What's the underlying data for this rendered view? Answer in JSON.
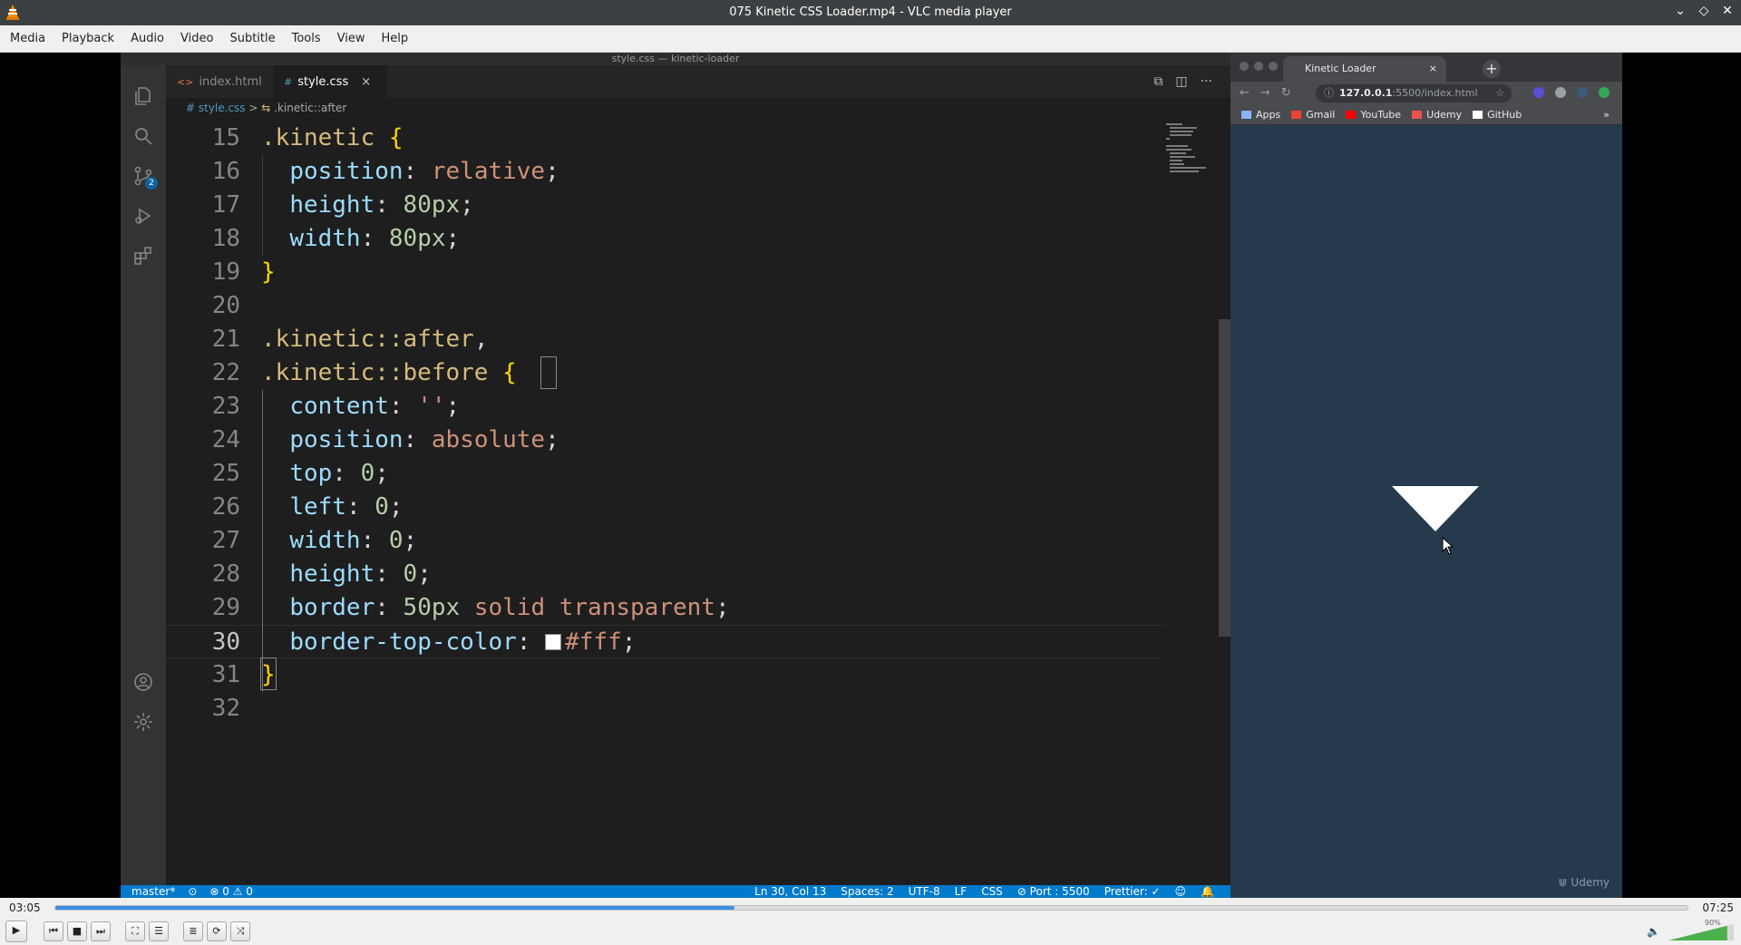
{
  "window": {
    "title": "075 Kinetic CSS Loader.mp4 - VLC media player",
    "controls": [
      "minimize-icon",
      "maximize-icon",
      "close-icon"
    ]
  },
  "menu": [
    "Media",
    "Playback",
    "Audio",
    "Video",
    "Subtitle",
    "Tools",
    "View",
    "Help"
  ],
  "vscode": {
    "window_title": "style.css — kinetic-loader",
    "tabs": [
      {
        "label": "index.html",
        "icon": "html-icon",
        "active": false
      },
      {
        "label": "style.css",
        "icon": "css-icon",
        "active": true,
        "close": "×"
      }
    ],
    "breadcrumb": {
      "file": "# style.css",
      "separator": ">",
      "symbol": ".kinetic::after"
    },
    "tab_actions": [
      "⧉",
      "◫",
      "···"
    ],
    "code_lines": [
      {
        "n": "15",
        "code": [
          {
            "t": "sel",
            "v": ".kinetic "
          },
          {
            "t": "brace",
            "v": "{"
          }
        ]
      },
      {
        "n": "16",
        "code": [
          {
            "t": "sp",
            "v": "  "
          },
          {
            "t": "prop",
            "v": "position"
          },
          {
            "t": "punc",
            "v": ": "
          },
          {
            "t": "val",
            "v": "relative"
          },
          {
            "t": "punc",
            "v": ";"
          }
        ]
      },
      {
        "n": "17",
        "code": [
          {
            "t": "sp",
            "v": "  "
          },
          {
            "t": "prop",
            "v": "height"
          },
          {
            "t": "punc",
            "v": ": "
          },
          {
            "t": "num",
            "v": "80px"
          },
          {
            "t": "punc",
            "v": ";"
          }
        ]
      },
      {
        "n": "18",
        "code": [
          {
            "t": "sp",
            "v": "  "
          },
          {
            "t": "prop",
            "v": "width"
          },
          {
            "t": "punc",
            "v": ": "
          },
          {
            "t": "num",
            "v": "80px"
          },
          {
            "t": "punc",
            "v": ";"
          }
        ]
      },
      {
        "n": "19",
        "code": [
          {
            "t": "brace",
            "v": "}"
          }
        ]
      },
      {
        "n": "20",
        "code": []
      },
      {
        "n": "21",
        "code": [
          {
            "t": "sel",
            "v": ".kinetic::after"
          },
          {
            "t": "punc",
            "v": ","
          }
        ]
      },
      {
        "n": "22",
        "code": [
          {
            "t": "sel",
            "v": ".kinetic::before "
          },
          {
            "t": "brace",
            "v": "{"
          }
        ]
      },
      {
        "n": "23",
        "code": [
          {
            "t": "sp",
            "v": "  "
          },
          {
            "t": "prop",
            "v": "content"
          },
          {
            "t": "punc",
            "v": ": "
          },
          {
            "t": "val",
            "v": "''"
          },
          {
            "t": "punc",
            "v": ";"
          }
        ]
      },
      {
        "n": "24",
        "code": [
          {
            "t": "sp",
            "v": "  "
          },
          {
            "t": "prop",
            "v": "position"
          },
          {
            "t": "punc",
            "v": ": "
          },
          {
            "t": "val",
            "v": "absolute"
          },
          {
            "t": "punc",
            "v": ";"
          }
        ]
      },
      {
        "n": "25",
        "code": [
          {
            "t": "sp",
            "v": "  "
          },
          {
            "t": "prop",
            "v": "top"
          },
          {
            "t": "punc",
            "v": ": "
          },
          {
            "t": "num",
            "v": "0"
          },
          {
            "t": "punc",
            "v": ";"
          }
        ]
      },
      {
        "n": "26",
        "code": [
          {
            "t": "sp",
            "v": "  "
          },
          {
            "t": "prop",
            "v": "left"
          },
          {
            "t": "punc",
            "v": ": "
          },
          {
            "t": "num",
            "v": "0"
          },
          {
            "t": "punc",
            "v": ";"
          }
        ]
      },
      {
        "n": "27",
        "code": [
          {
            "t": "sp",
            "v": "  "
          },
          {
            "t": "prop",
            "v": "width"
          },
          {
            "t": "punc",
            "v": ": "
          },
          {
            "t": "num",
            "v": "0"
          },
          {
            "t": "punc",
            "v": ";"
          }
        ]
      },
      {
        "n": "28",
        "code": [
          {
            "t": "sp",
            "v": "  "
          },
          {
            "t": "prop",
            "v": "height"
          },
          {
            "t": "punc",
            "v": ": "
          },
          {
            "t": "num",
            "v": "0"
          },
          {
            "t": "punc",
            "v": ";"
          }
        ]
      },
      {
        "n": "29",
        "code": [
          {
            "t": "sp",
            "v": "  "
          },
          {
            "t": "prop",
            "v": "border"
          },
          {
            "t": "punc",
            "v": ": "
          },
          {
            "t": "num",
            "v": "50px"
          },
          {
            "t": "val",
            "v": " solid transparent"
          },
          {
            "t": "punc",
            "v": ";"
          }
        ]
      },
      {
        "n": "30",
        "code": [
          {
            "t": "sp",
            "v": "  "
          },
          {
            "t": "prop",
            "v": "border-top-color"
          },
          {
            "t": "punc",
            "v": ": "
          },
          {
            "t": "swatch",
            "v": ""
          },
          {
            "t": "val",
            "v": "#fff"
          },
          {
            "t": "punc",
            "v": ";"
          }
        ]
      },
      {
        "n": "31",
        "code": [
          {
            "t": "brace",
            "v": "}"
          }
        ]
      },
      {
        "n": "32",
        "code": []
      }
    ],
    "current_line": "30",
    "status": {
      "branch": "master*",
      "sync": "⊙",
      "problems": "⊗ 0 ⚠ 0",
      "position": "Ln 30, Col 13",
      "spaces": "Spaces: 2",
      "encoding": "UTF-8",
      "eol": "LF",
      "language": "CSS",
      "port": "⊘ Port : 5500",
      "prettier": "Prettier: ✓"
    }
  },
  "browser": {
    "tab_title": "Kinetic Loader",
    "tab_close": "×",
    "new_tab": "+",
    "url_host": "127.0.0.1",
    "url_path": ":5500/index.html",
    "bookmarks": [
      {
        "label": "Apps",
        "icon": "apps-icon",
        "color": "#8ab4f8"
      },
      {
        "label": "Gmail",
        "icon": "gmail-icon",
        "color": "#ea4335"
      },
      {
        "label": "YouTube",
        "icon": "youtube-icon",
        "color": "#ff0000"
      },
      {
        "label": "Udemy",
        "icon": "udemy-icon",
        "color": "#ec5252"
      },
      {
        "label": "GitHub",
        "icon": "github-icon",
        "color": "#ffffff"
      }
    ],
    "page_bg": "#253a4d",
    "watermark": "Udemy"
  },
  "player": {
    "elapsed": "03:05",
    "total": "07:25",
    "progress": 0.416,
    "volume_label": "90%",
    "volume": 0.9,
    "accent": "#3a8ee6"
  }
}
